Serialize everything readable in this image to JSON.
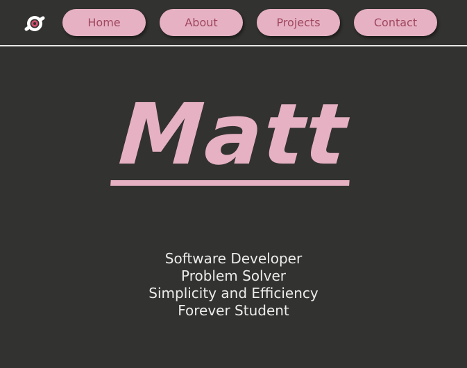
{
  "nav": {
    "items": [
      {
        "label": "Home"
      },
      {
        "label": "About"
      },
      {
        "label": "Projects"
      },
      {
        "label": "Contact"
      }
    ]
  },
  "hero": {
    "name": "Matt"
  },
  "taglines": [
    "Software Developer",
    "Problem Solver",
    "Simplicity and Efficiency",
    "Forever Student"
  ],
  "colors": {
    "background": "#323230",
    "accent_pink": "#e6b1c3",
    "button_text": "#a0475f",
    "body_text": "#ececea"
  },
  "icons": {
    "logo": "disc-with-bar-logo-icon"
  }
}
